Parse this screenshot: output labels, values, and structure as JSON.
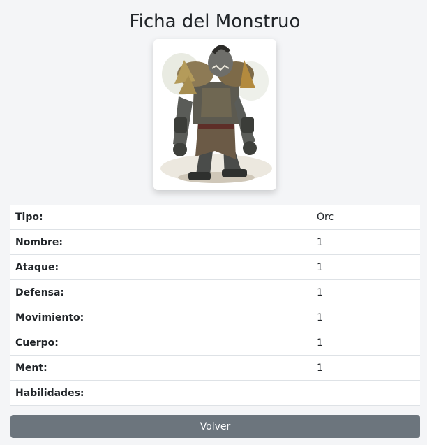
{
  "page": {
    "title": "Ficha del Monstruo"
  },
  "image": {
    "subject": "orc-warrior-illustration"
  },
  "stats": {
    "rows": [
      {
        "label": "Tipo:",
        "value": "Orc"
      },
      {
        "label": "Nombre:",
        "value": "1"
      },
      {
        "label": "Ataque:",
        "value": "1"
      },
      {
        "label": "Defensa:",
        "value": "1"
      },
      {
        "label": "Movimiento:",
        "value": "1"
      },
      {
        "label": "Cuerpo:",
        "value": "1"
      },
      {
        "label": "Ment:",
        "value": "1"
      },
      {
        "label": "Habilidades:",
        "value": ""
      }
    ]
  },
  "actions": {
    "back_label": "Volver"
  },
  "colors": {
    "background": "#f4f5f7",
    "button": "#6c757d",
    "button_text": "#ffffff",
    "row_border": "#dee2e6"
  }
}
